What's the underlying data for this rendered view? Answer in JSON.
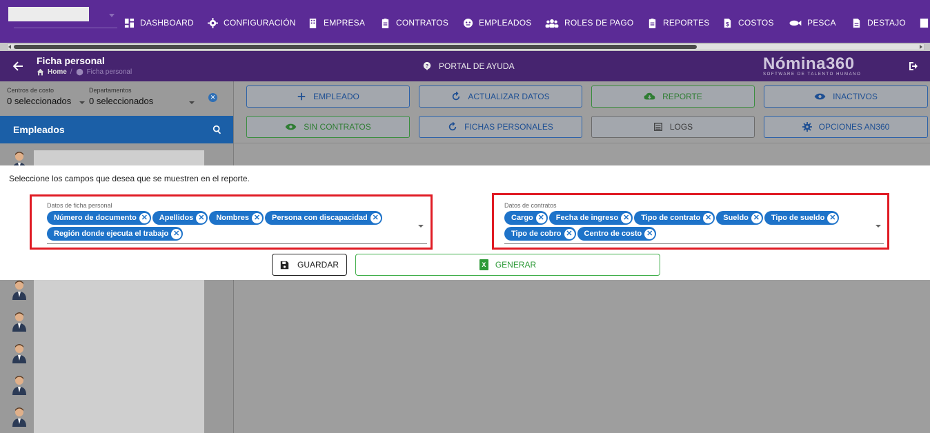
{
  "nav": {
    "items": [
      {
        "label": "DASHBOARD",
        "icon": "dashboard-icon"
      },
      {
        "label": "CONFIGURACIÓN",
        "icon": "gear-icon"
      },
      {
        "label": "EMPRESA",
        "icon": "building-icon"
      },
      {
        "label": "CONTRATOS",
        "icon": "clipboard-icon"
      },
      {
        "label": "EMPLEADOS",
        "icon": "employees-icon"
      },
      {
        "label": "ROLES DE PAGO",
        "icon": "users-icon"
      },
      {
        "label": "REPORTES",
        "icon": "clipboard-icon"
      },
      {
        "label": "COSTOS",
        "icon": "file-dollar-icon"
      },
      {
        "label": "PESCA",
        "icon": "fish-icon"
      },
      {
        "label": "DESTAJO",
        "icon": "file-icon"
      }
    ]
  },
  "header": {
    "title": "Ficha personal",
    "breadcrumb_home": "Home",
    "breadcrumb_sep": "/",
    "breadcrumb_current": "Ficha personal",
    "help_label": "PORTAL DE AYUDA",
    "brand_name": "Nómina360",
    "brand_tagline": "SOFTWARE DE TALENTO HUMANO"
  },
  "filters": {
    "cost_centers_label": "Centros de costo",
    "cost_centers_value": "0 seleccionados",
    "departments_label": "Departamentos",
    "departments_value": "0 seleccionados"
  },
  "employees": {
    "header": "Empleados"
  },
  "actions": {
    "row1": [
      {
        "label": "EMPLEADO",
        "icon": "plus-icon",
        "style": "blue"
      },
      {
        "label": "ACTUALIZAR DATOS",
        "icon": "refresh-icon",
        "style": "blue"
      },
      {
        "label": "REPORTE",
        "icon": "cloud-download-icon",
        "style": "green"
      },
      {
        "label": "INACTIVOS",
        "icon": "eye-icon",
        "style": "blue"
      }
    ],
    "row2": [
      {
        "label": "SIN CONTRATOS",
        "icon": "eye-icon",
        "style": "green"
      },
      {
        "label": "FICHAS PERSONALES",
        "icon": "refresh-icon",
        "style": "blue"
      },
      {
        "label": "LOGS",
        "icon": "list-icon",
        "style": "gray"
      },
      {
        "label": "OPCIONES AN360",
        "icon": "gear-icon",
        "style": "blue"
      }
    ]
  },
  "modal": {
    "instruction": "Seleccione los campos que desea que se muestren en el reporte.",
    "personal_label": "Datos de ficha personal",
    "personal_chips": [
      "Número de documento",
      "Apellidos",
      "Nombres",
      "Persona con discapacidad",
      "Región donde ejecuta el trabajo"
    ],
    "contracts_label": "Datos de contratos",
    "contract_chips": [
      "Cargo",
      "Fecha de ingreso",
      "Tipo de contrato",
      "Sueldo",
      "Tipo de sueldo",
      "Tipo de cobro",
      "Centro de costo"
    ],
    "save_label": "GUARDAR",
    "generate_label": "GENERAR",
    "highlight_color": "#e01b24",
    "chip_color": "#1e73c9"
  }
}
